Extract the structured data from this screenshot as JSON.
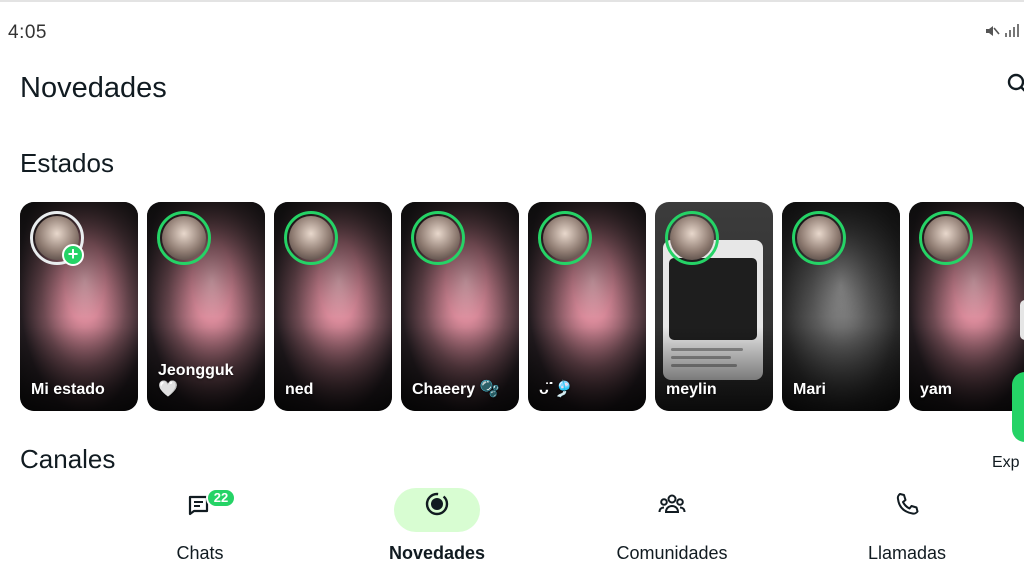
{
  "status_bar": {
    "time": "4:05",
    "icons": [
      "mute-icon",
      "signal-icon"
    ]
  },
  "header": {
    "title": "Novedades",
    "search_icon": "search-icon"
  },
  "sections": {
    "estados": "Estados",
    "canales": "Canales"
  },
  "statuses": [
    {
      "label": "Mi estado",
      "mine": true
    },
    {
      "label": "Jeongguk",
      "emoji": "🤍"
    },
    {
      "label": "ned"
    },
    {
      "label": "Chaeery 🫧"
    },
    {
      "label": "ᴗ̈ᐝ🎐"
    },
    {
      "label": "meylin"
    },
    {
      "label": "Mari"
    },
    {
      "label": "yam"
    }
  ],
  "explore": {
    "label": "Exp"
  },
  "nav": [
    {
      "label": "Chats",
      "badge": "22",
      "active": false,
      "icon": "chat-icon"
    },
    {
      "label": "Novedades",
      "active": true,
      "icon": "updates-icon"
    },
    {
      "label": "Comunidades",
      "active": false,
      "icon": "communities-icon"
    },
    {
      "label": "Llamadas",
      "active": false,
      "icon": "phone-icon"
    }
  ],
  "colors": {
    "accent": "#25d366",
    "active_pill": "#d8fdd2",
    "text": "#111b21"
  }
}
